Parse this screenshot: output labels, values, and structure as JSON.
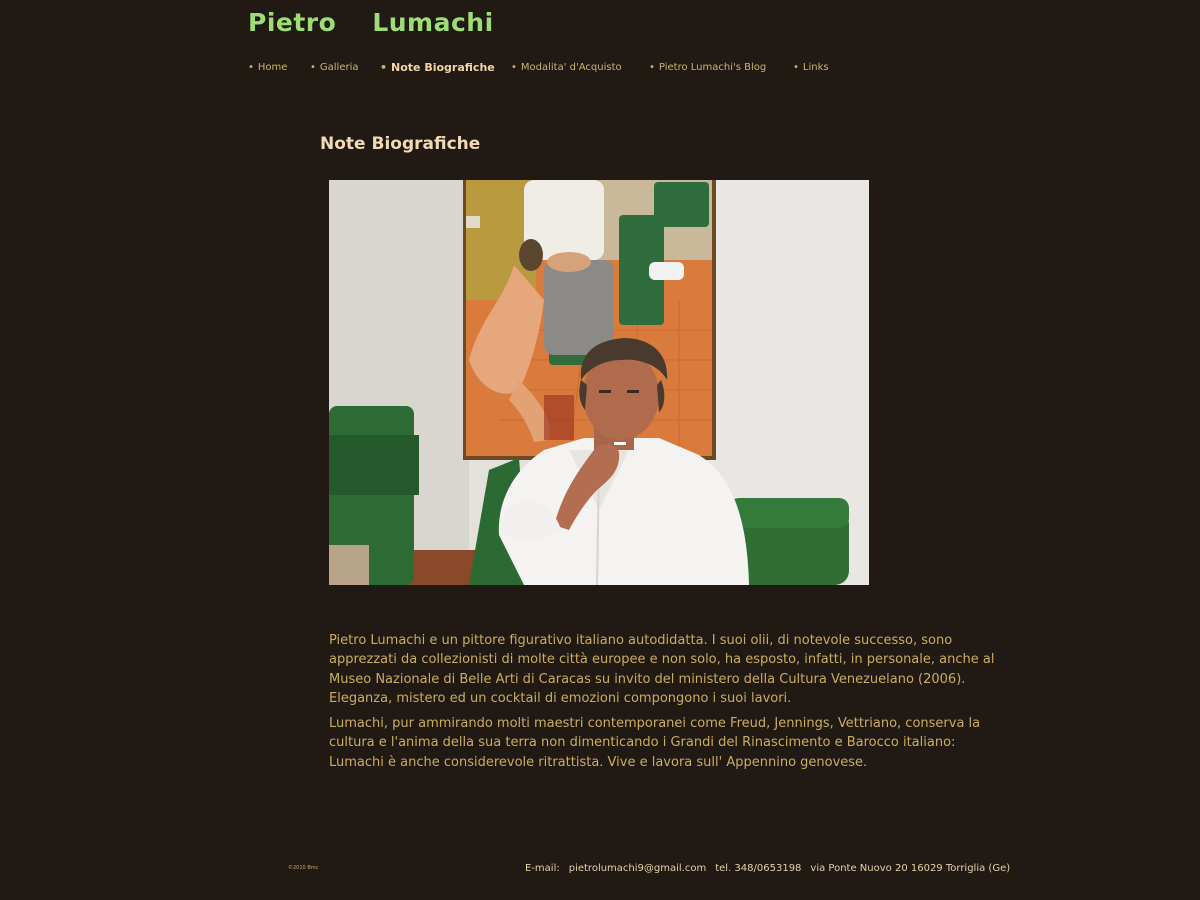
{
  "site": {
    "title_first": "Pietro",
    "title_last": "Lumachi"
  },
  "nav": {
    "bullet": "•",
    "items": [
      {
        "label": "Home",
        "active": false
      },
      {
        "label": "Galleria",
        "active": false
      },
      {
        "label": "Note  Biografiche",
        "active": true
      },
      {
        "label": "Modalita' d'Acquisto",
        "active": false
      },
      {
        "label": "Pietro Lumachi's Blog",
        "active": false
      },
      {
        "label": "Links",
        "active": false
      }
    ]
  },
  "main": {
    "heading": "Note Biografiche",
    "photo_subject": "artist-portrait-in-studio",
    "paragraphs": [
      "Pietro Lumachi e un pittore figurativo italiano autodidatta. I suoi olii, di notevole successo, sono apprezzati da collezionisti di molte città europee e non solo, ha esposto, infatti, in personale, anche al Museo Nazionale di Belle Arti di Caracas su invito del ministero della Cultura Venezuelano (2006). Eleganza, mistero ed un cocktail di emozioni compongono i suoi lavori.",
      "Lumachi, pur ammirando molti maestri contemporanei come Freud, Jennings, Vettriano, conserva la cultura e l'anima della sua terra non dimenticando i Grandi del Rinascimento e Barocco italiano: Lumachi è anche considerevole ritrattista. Vive e lavora sull' Appennino genovese."
    ]
  },
  "footer": {
    "copyright": "©2010 Bmc",
    "email_label": "E-mail:",
    "email": "pietrolumachi9@gmail.com",
    "phone": "tel. 348/0653198",
    "address": "via Ponte Nuovo 20 16029 Torriglia (Ge)"
  },
  "colors": {
    "background": "#211914",
    "title": "#9ddd74",
    "nav": "#cdb36e",
    "heading": "#f4d9b7",
    "body_text": "#cbae5c"
  }
}
